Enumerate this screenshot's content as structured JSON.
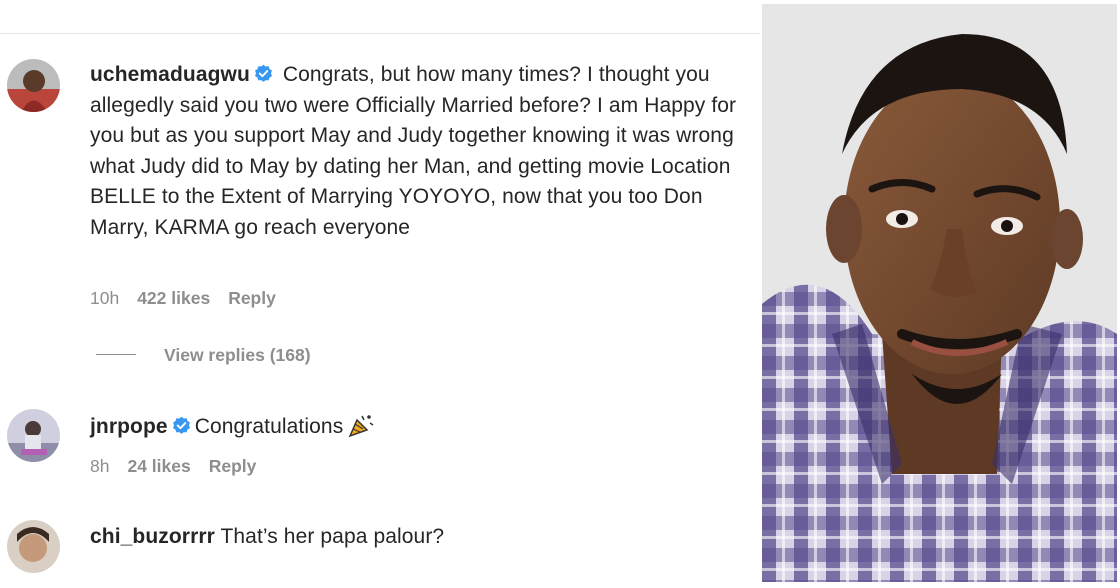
{
  "comments": [
    {
      "username": "uchemaduagwu",
      "text": "Congrats, but how many times? I thought you allegedly said you two were Officially Married before? I am Happy for you but as you support May and Judy together knowing it was wrong what Judy did to May by dating her Man, and getting movie Location BELLE to the Extent of Marrying YOYOYO, now that you too Don Marry, KARMA go reach everyone",
      "time": "10h",
      "likes": "422 likes",
      "reply": "Reply",
      "view_replies": "View replies (168)"
    },
    {
      "username": "jnrpope",
      "text": "Congratulations",
      "time": "8h",
      "likes": "24 likes",
      "reply": "Reply"
    },
    {
      "username": "chi_buzorrrr",
      "text": "That’s her papa palour?"
    }
  ],
  "colors": {
    "verified": "#3897f0",
    "meta": "#8e8e8e",
    "text": "#262626"
  },
  "icons": {
    "verified": "verified-badge-icon",
    "party": "party-popper-icon"
  }
}
